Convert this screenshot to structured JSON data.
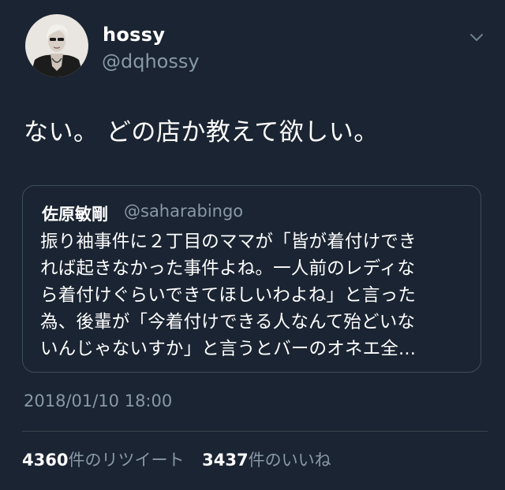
{
  "colors": {
    "background": "#1b2432",
    "primary_text": "#ffffff",
    "secondary_text": "#8899a6",
    "border": "#3d4d5e"
  },
  "icons": {
    "menu": "chevron-down-icon"
  },
  "tweet": {
    "author_name": "hossy",
    "author_handle": "@dqhossy",
    "text": "ない。 どの店か教えて欲しい。",
    "quoted": {
      "author_name": "佐原敏剛",
      "author_handle": "@saharabingo",
      "lines": [
        "振り袖事件に２丁目のママが「皆が着付けでき",
        "れば起きなかった事件よね。一人前のレディな",
        "ら着付けぐらいできてほしいわよね」と言った",
        "為、後輩が「今着付けできる人なんて殆どいな",
        "いんじゃないすか」と言うとバーのオネエ全..."
      ]
    },
    "timestamp": "2018/01/10 18:00",
    "stats": {
      "retweet_count": "4360",
      "retweet_label": "件のリツイート",
      "like_count": "3437",
      "like_label": "件のいいね"
    }
  }
}
